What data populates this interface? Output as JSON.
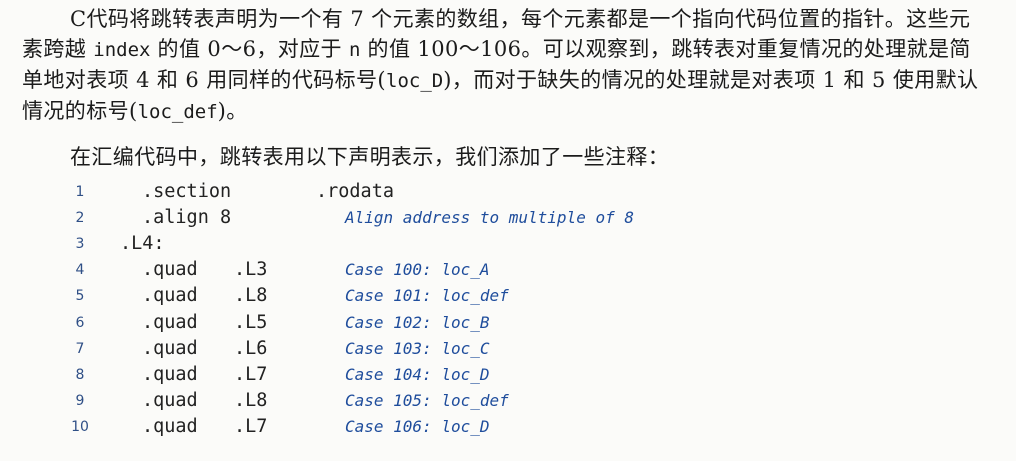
{
  "paragraph1": {
    "t1": "C代码将跳转表声明为一个有 7 个元素的数组，每个元素都是一个指向代码位置的指针。这些元素跨越 ",
    "c1": "index",
    "t2": " 的值 0～6，对应于 ",
    "c2": "n",
    "t3": " 的值 100～106。可以观察到，跳转表对重复情况的处理就是简单地对表项 4 和 6 用同样的代码标号(",
    "c3": "loc_D",
    "t4": ")，而对于缺失的情况的处理就是对表项 1 和 5 使用默认情况的标号(",
    "c4": "loc_def",
    "t5": ")。"
  },
  "paragraph2": "在汇编代码中，跳转表用以下声明表示，我们添加了一些注释：",
  "code": [
    {
      "num": "1",
      "a": ".section",
      "b": ".rodata",
      "comment": ""
    },
    {
      "num": "2",
      "a": ".align 8",
      "b": "",
      "comment": "Align address to multiple of 8"
    },
    {
      "num": "3",
      "a": ".L4:",
      "b": "",
      "comment": ""
    },
    {
      "num": "4",
      "a": ".quad",
      "b": ".L3",
      "comment": "Case 100: loc_A"
    },
    {
      "num": "5",
      "a": ".quad",
      "b": ".L8",
      "comment": "Case 101: loc_def"
    },
    {
      "num": "6",
      "a": ".quad",
      "b": ".L5",
      "comment": "Case 102: loc_B"
    },
    {
      "num": "7",
      "a": ".quad",
      "b": ".L6",
      "comment": "Case 103: loc_C"
    },
    {
      "num": "8",
      "a": ".quad",
      "b": ".L7",
      "comment": "Case 104: loc_D"
    },
    {
      "num": "9",
      "a": ".quad",
      "b": ".L8",
      "comment": "Case 105: loc_def"
    },
    {
      "num": "10",
      "a": ".quad",
      "b": ".L7",
      "comment": "Case 106: loc_D"
    }
  ]
}
